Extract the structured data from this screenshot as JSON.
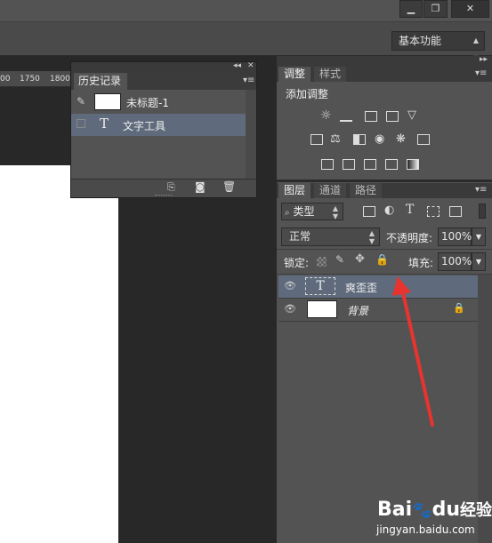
{
  "window": {
    "minimize_label": "▁",
    "restore_label": "❐",
    "close_label": "✕",
    "workspace_label": "基本功能"
  },
  "ruler": {
    "ticks": [
      "00",
      "1750",
      "1800"
    ]
  },
  "history_panel": {
    "tab_label": "历史记录",
    "items": [
      {
        "label": "未标题-1"
      },
      {
        "label": "文字工具"
      }
    ]
  },
  "adjust_panel": {
    "tabs": [
      "调整",
      "样式"
    ],
    "title": "添加调整"
  },
  "layers_panel": {
    "tabs": [
      "图层",
      "通道",
      "路径"
    ],
    "filter_label": "类型",
    "blend_mode": "正常",
    "opacity_label": "不透明度:",
    "opacity_value": "100%",
    "lock_label": "锁定:",
    "fill_label": "填充:",
    "fill_value": "100%",
    "layers": [
      {
        "name": "爽歪歪",
        "type": "text",
        "selected": true
      },
      {
        "name": "背景",
        "type": "background",
        "locked": true
      }
    ]
  },
  "watermark": {
    "brand": "Bai",
    "brand2": "du",
    "suffix": "经验",
    "url": "jingyan.baidu.com"
  },
  "colors": {
    "selected_row": "#5f6b7c",
    "annotation_arrow": "#e8332f"
  }
}
